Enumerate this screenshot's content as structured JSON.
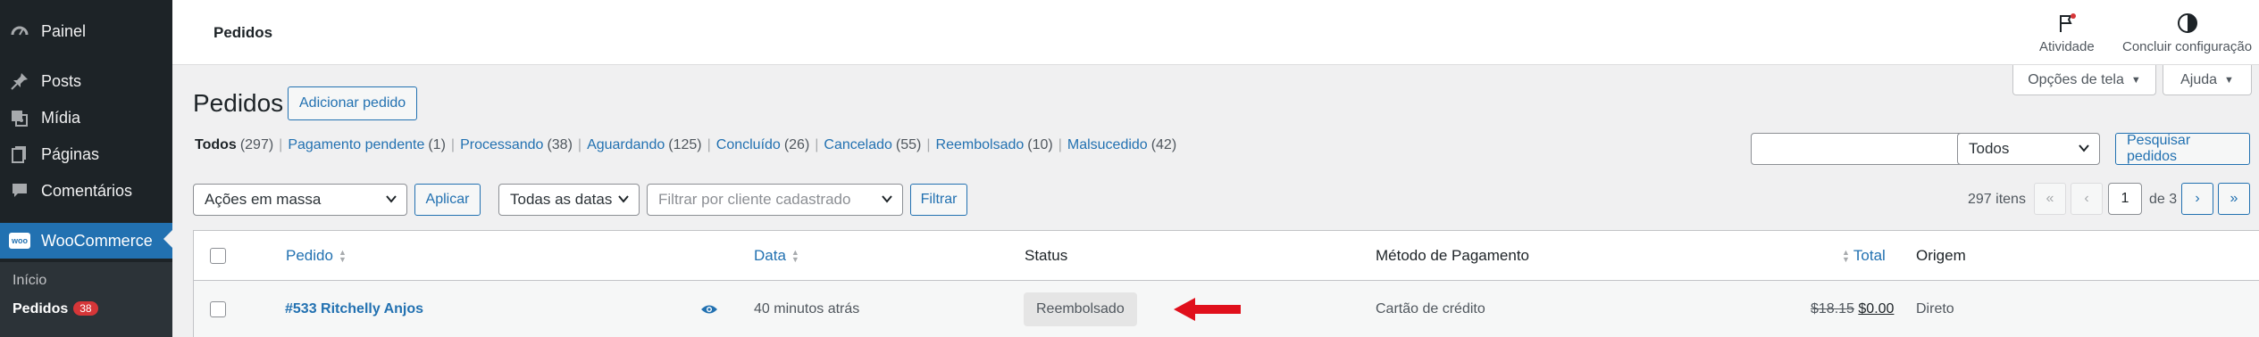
{
  "sidebar": {
    "items": [
      {
        "label": "Painel",
        "icon": "dashboard-icon"
      },
      {
        "label": "Posts",
        "icon": "pin-icon"
      },
      {
        "label": "Mídia",
        "icon": "media-icon"
      },
      {
        "label": "Páginas",
        "icon": "pages-icon"
      },
      {
        "label": "Comentários",
        "icon": "comment-icon"
      },
      {
        "label": "WooCommerce",
        "icon": "woocommerce-icon",
        "logo_text": "woo"
      }
    ],
    "submenu": [
      {
        "label": "Início"
      },
      {
        "label": "Pedidos",
        "badge": "38"
      }
    ]
  },
  "header": {
    "title": "Pedidos",
    "actions": [
      {
        "label": "Atividade",
        "icon": "flag-icon"
      },
      {
        "label": "Concluir configuração",
        "icon": "half-circle-icon"
      }
    ]
  },
  "screen_options": {
    "label": "Opções de tela"
  },
  "help": {
    "label": "Ajuda"
  },
  "page": {
    "title": "Pedidos",
    "add_button": "Adicionar pedido"
  },
  "status_filters": [
    {
      "label": "Todos",
      "count": "(297)",
      "current": true
    },
    {
      "label": "Pagamento pendente",
      "count": "(1)"
    },
    {
      "label": "Processando",
      "count": "(38)"
    },
    {
      "label": "Aguardando",
      "count": "(125)"
    },
    {
      "label": "Concluído",
      "count": "(26)"
    },
    {
      "label": "Cancelado",
      "count": "(55)"
    },
    {
      "label": "Reembolsado",
      "count": "(10)"
    },
    {
      "label": "Malsucedido",
      "count": "(42)"
    }
  ],
  "search": {
    "value": "",
    "select_value": "Todos",
    "button": "Pesquisar pedidos"
  },
  "bulk": {
    "select_value": "Ações em massa",
    "apply": "Aplicar",
    "dates_value": "Todas as datas",
    "customer_placeholder": "Filtrar por cliente cadastrado",
    "filter": "Filtrar"
  },
  "pagination": {
    "items": "297 itens",
    "first": "«",
    "prev": "‹",
    "current": "1",
    "of": "de 3",
    "next": "›",
    "last": "»"
  },
  "table": {
    "headers": {
      "order": "Pedido",
      "date": "Data",
      "status": "Status",
      "payment": "Método de Pagamento",
      "total": "Total",
      "origin": "Origem"
    },
    "rows": [
      {
        "order": "#533 Ritchelly Anjos",
        "date": "40 minutos atrás",
        "status": "Reembolsado",
        "payment": "Cartão de crédito",
        "total_original": "$18.15",
        "total_current": "$0.00",
        "origin": "Direto"
      }
    ]
  },
  "colors": {
    "accent": "#2271b1",
    "sidebar": "#1d2327",
    "annotation_arrow": "#e0101c",
    "badge": "#d63638"
  }
}
